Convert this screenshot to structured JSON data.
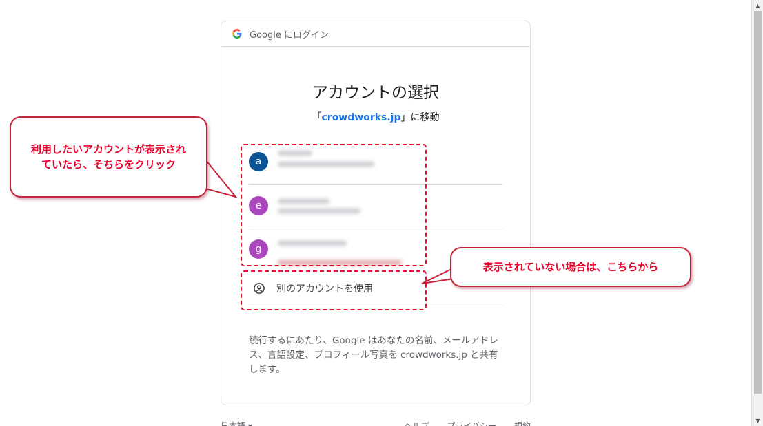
{
  "header": {
    "text": "Google にログイン"
  },
  "title": "アカウントの選択",
  "subtitle": {
    "prefix": "「",
    "link": "crowdworks.jp",
    "suffix": "」に移動"
  },
  "accounts": [
    {
      "initial": "a",
      "color": "#0b5394"
    },
    {
      "initial": "e",
      "color": "#ab47bc"
    },
    {
      "initial": "g",
      "color": "#ab47bc"
    }
  ],
  "use_other": {
    "label": "別のアカウントを使用"
  },
  "notice": "続行するにあたり、Google はあなたの名前、メールアドレス、言語設定、プロフィール写真を crowdworks.jp と共有します。",
  "footer": {
    "language": "日本語 ▾",
    "links": [
      "ヘルプ",
      "プライバシー",
      "規約"
    ]
  },
  "annotations": {
    "left_callout": "利用したいアカウントが表示されていたら、そちらをクリック",
    "right_callout": "表示されていない場合は、こちらから",
    "accent_color": "#e8112d"
  }
}
